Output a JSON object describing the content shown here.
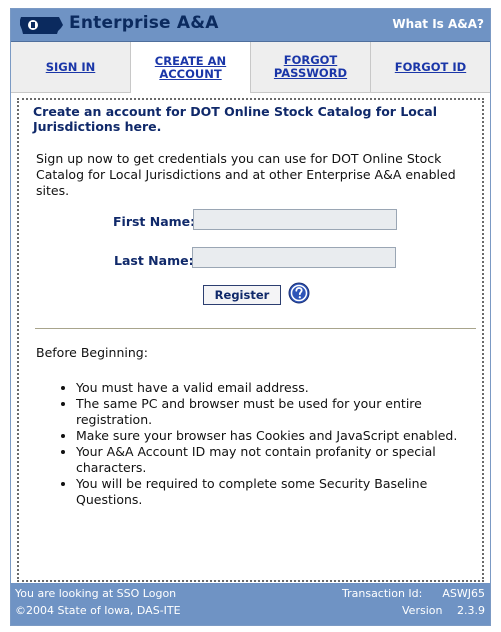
{
  "header": {
    "title": "Enterprise A&A",
    "help_link": "What Is A&A?",
    "logo": "iowa-state-logo-icon"
  },
  "tabs": [
    {
      "label": "SIGN IN",
      "active": false
    },
    {
      "label": "CREATE AN ACCOUNT",
      "active": true
    },
    {
      "label": "FORGOT PASSWORD",
      "active": false
    },
    {
      "label": "FORGOT ID",
      "active": false
    }
  ],
  "content": {
    "intro_title": "Create an account for DOT Online Stock Catalog for Local Jurisdictions here.",
    "intro_text": "Sign up now to get credentials you can use for DOT Online Stock Catalog for Local Jurisdictions and at other Enterprise A&A enabled sites.",
    "first_name_label": "First Name:",
    "first_name_value": "",
    "last_name_label": "Last Name:",
    "last_name_value": "",
    "register_label": "Register",
    "help_icon": "question-icon",
    "before_title": "Before Beginning:",
    "bullets": [
      "You must have a valid email address.",
      "The same PC and browser must be used for your entire registration.",
      "Make sure your browser has Cookies and JavaScript enabled.",
      "Your A&A Account ID may not contain profanity or special characters.",
      "You will be required to complete some Security Baseline Questions."
    ]
  },
  "footer": {
    "sso_text": "You are looking at SSO Logon",
    "copyright": "©2004 State of Iowa, DAS-ITE",
    "transaction_label": "Transaction Id:",
    "transaction_id": "ASWJ65",
    "version_label": "Version",
    "version": "2.3.9"
  },
  "colors": {
    "header_bg": "#6f93c4",
    "title_text": "#0b2a5e",
    "link": "#1a36a8",
    "label_text": "#10296a"
  }
}
